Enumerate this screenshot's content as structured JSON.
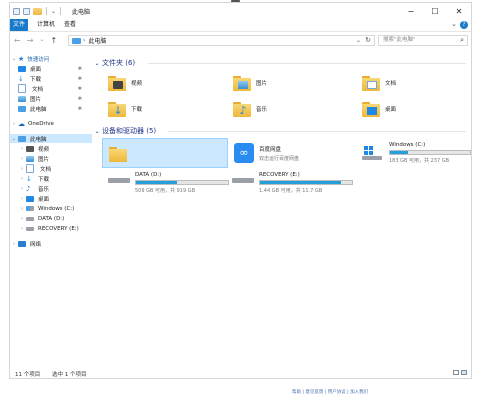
{
  "window": {
    "title": "此电脑",
    "controls": {
      "minimize": "−",
      "maximize": "☐",
      "close": "✕"
    }
  },
  "ribbon": {
    "tabs": [
      "文件",
      "计算机",
      "查看"
    ],
    "collapse": "⌄",
    "help": "?"
  },
  "nav": {
    "back": "←",
    "forward": "→",
    "recent": "⌄",
    "up": "↑",
    "address": "此电脑",
    "address_dropdown": "⌄",
    "refresh": "↻",
    "search_placeholder": "搜索\"此电脑\"",
    "search_icon": "⌕"
  },
  "sidebar": {
    "items": [
      {
        "label": "快速访问",
        "icon": "star-icon",
        "color": "#2b7cd3",
        "chev": "⌄"
      },
      {
        "label": "桌面",
        "icon": "desktop-icon",
        "color": "#1e88e5",
        "pin": "✱"
      },
      {
        "label": "下载",
        "icon": "download-icon",
        "color": "#1e88e5",
        "pin": "✱"
      },
      {
        "label": "文档",
        "icon": "document-icon",
        "color": "#7aa7d8",
        "pin": "✱"
      },
      {
        "label": "图片",
        "icon": "picture-icon",
        "color": "#4aa3df",
        "pin": "✱"
      },
      {
        "label": "此电脑",
        "icon": "computer-icon",
        "color": "#4a9fe6",
        "pin": "✱"
      },
      {
        "label": "OneDrive",
        "icon": "cloud-icon",
        "color": "#1565c0",
        "chev": "›"
      },
      {
        "label": "此电脑",
        "icon": "computer-icon",
        "color": "#4a9fe6",
        "chev": "⌄"
      },
      {
        "label": "视频",
        "icon": "video-icon",
        "color": "#555555",
        "chev": "›"
      },
      {
        "label": "图片",
        "icon": "picture-icon",
        "color": "#4aa3df",
        "chev": "›"
      },
      {
        "label": "文档",
        "icon": "document-icon",
        "color": "#7aa7d8",
        "chev": "›"
      },
      {
        "label": "下载",
        "icon": "download-icon",
        "color": "#1e88e5",
        "chev": "›"
      },
      {
        "label": "音乐",
        "icon": "music-icon",
        "color": "#1e88e5",
        "chev": "›"
      },
      {
        "label": "桌面",
        "icon": "desktop-icon",
        "color": "#1e88e5",
        "chev": "›"
      },
      {
        "label": "Windows (C:)",
        "icon": "windows-drive-icon",
        "color": "#4a9fe6",
        "chev": "›"
      },
      {
        "label": "DATA (D:)",
        "icon": "drive-icon",
        "color": "#666666",
        "chev": "›"
      },
      {
        "label": "RECOVERY (E:)",
        "icon": "drive-icon",
        "color": "#666666",
        "chev": "›"
      },
      {
        "label": "网络",
        "icon": "network-icon",
        "color": "#2b7cd3",
        "chev": "›"
      }
    ]
  },
  "folders_section": {
    "title": "文件夹 (6)",
    "chev": "⌄",
    "items": [
      {
        "label": "视频",
        "icon": "video-folder-icon"
      },
      {
        "label": "图片",
        "icon": "picture-folder-icon"
      },
      {
        "label": "文档",
        "icon": "document-folder-icon"
      },
      {
        "label": "下载",
        "icon": "download-folder-icon"
      },
      {
        "label": "音乐",
        "icon": "music-folder-icon"
      },
      {
        "label": "桌面",
        "icon": "desktop-folder-icon"
      }
    ]
  },
  "devices_section": {
    "title": "设备和驱动器 (5)",
    "chev": "⌄",
    "items": [
      {
        "kind": "folder",
        "name": "",
        "icon": "folder-icon"
      },
      {
        "kind": "app",
        "name": "百度网盘",
        "sub": "双击运行百度网盘",
        "icon": "baidu-netdisk-icon"
      },
      {
        "kind": "drive",
        "name": "Windows (C:)",
        "sub": "183 GB 可用，共 237 GB",
        "used_fraction": 0.23,
        "icon": "windows-drive-icon"
      },
      {
        "kind": "drive",
        "name": "DATA (D:)",
        "sub": "509 GB 可用，共 919 GB",
        "used_fraction": 0.45,
        "icon": "drive-icon"
      },
      {
        "kind": "drive",
        "name": "RECOVERY (E:)",
        "sub": "1.44 GB 可用，共 11.7 GB",
        "used_fraction": 0.88,
        "icon": "drive-icon"
      }
    ]
  },
  "status": {
    "count": "11 个项目",
    "selected": "选中 1 个项目"
  },
  "footer": {
    "text": "帮助 | 意见反馈 | 用户协议 | 加入我们"
  },
  "colors": {
    "accent": "#1979ca",
    "selection": "#cce8ff",
    "bar_fill": "#26a0da",
    "section_title": "#1e3287"
  }
}
